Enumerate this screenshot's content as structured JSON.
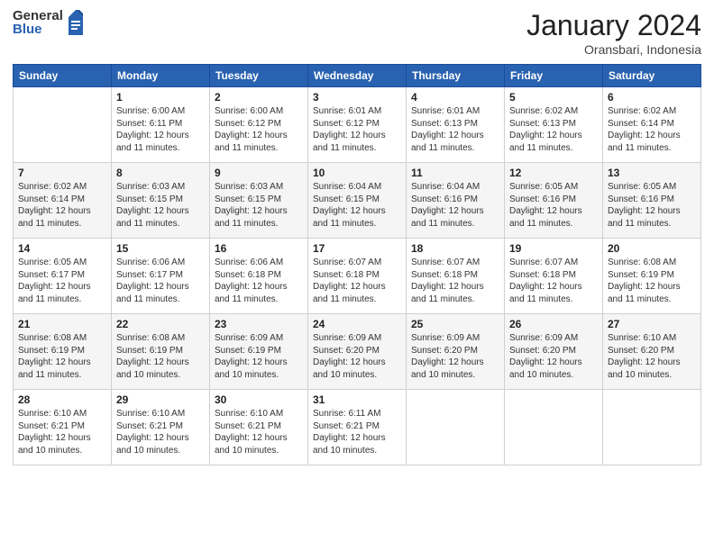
{
  "header": {
    "logo_general": "General",
    "logo_blue": "Blue",
    "title": "January 2024",
    "location": "Oransbari, Indonesia"
  },
  "weekdays": [
    "Sunday",
    "Monday",
    "Tuesday",
    "Wednesday",
    "Thursday",
    "Friday",
    "Saturday"
  ],
  "weeks": [
    [
      {
        "day": "",
        "sunrise": "",
        "sunset": "",
        "daylight": ""
      },
      {
        "day": "1",
        "sunrise": "Sunrise: 6:00 AM",
        "sunset": "Sunset: 6:11 PM",
        "daylight": "Daylight: 12 hours and 11 minutes."
      },
      {
        "day": "2",
        "sunrise": "Sunrise: 6:00 AM",
        "sunset": "Sunset: 6:12 PM",
        "daylight": "Daylight: 12 hours and 11 minutes."
      },
      {
        "day": "3",
        "sunrise": "Sunrise: 6:01 AM",
        "sunset": "Sunset: 6:12 PM",
        "daylight": "Daylight: 12 hours and 11 minutes."
      },
      {
        "day": "4",
        "sunrise": "Sunrise: 6:01 AM",
        "sunset": "Sunset: 6:13 PM",
        "daylight": "Daylight: 12 hours and 11 minutes."
      },
      {
        "day": "5",
        "sunrise": "Sunrise: 6:02 AM",
        "sunset": "Sunset: 6:13 PM",
        "daylight": "Daylight: 12 hours and 11 minutes."
      },
      {
        "day": "6",
        "sunrise": "Sunrise: 6:02 AM",
        "sunset": "Sunset: 6:14 PM",
        "daylight": "Daylight: 12 hours and 11 minutes."
      }
    ],
    [
      {
        "day": "7",
        "sunrise": "Sunrise: 6:02 AM",
        "sunset": "Sunset: 6:14 PM",
        "daylight": "Daylight: 12 hours and 11 minutes."
      },
      {
        "day": "8",
        "sunrise": "Sunrise: 6:03 AM",
        "sunset": "Sunset: 6:15 PM",
        "daylight": "Daylight: 12 hours and 11 minutes."
      },
      {
        "day": "9",
        "sunrise": "Sunrise: 6:03 AM",
        "sunset": "Sunset: 6:15 PM",
        "daylight": "Daylight: 12 hours and 11 minutes."
      },
      {
        "day": "10",
        "sunrise": "Sunrise: 6:04 AM",
        "sunset": "Sunset: 6:15 PM",
        "daylight": "Daylight: 12 hours and 11 minutes."
      },
      {
        "day": "11",
        "sunrise": "Sunrise: 6:04 AM",
        "sunset": "Sunset: 6:16 PM",
        "daylight": "Daylight: 12 hours and 11 minutes."
      },
      {
        "day": "12",
        "sunrise": "Sunrise: 6:05 AM",
        "sunset": "Sunset: 6:16 PM",
        "daylight": "Daylight: 12 hours and 11 minutes."
      },
      {
        "day": "13",
        "sunrise": "Sunrise: 6:05 AM",
        "sunset": "Sunset: 6:16 PM",
        "daylight": "Daylight: 12 hours and 11 minutes."
      }
    ],
    [
      {
        "day": "14",
        "sunrise": "Sunrise: 6:05 AM",
        "sunset": "Sunset: 6:17 PM",
        "daylight": "Daylight: 12 hours and 11 minutes."
      },
      {
        "day": "15",
        "sunrise": "Sunrise: 6:06 AM",
        "sunset": "Sunset: 6:17 PM",
        "daylight": "Daylight: 12 hours and 11 minutes."
      },
      {
        "day": "16",
        "sunrise": "Sunrise: 6:06 AM",
        "sunset": "Sunset: 6:18 PM",
        "daylight": "Daylight: 12 hours and 11 minutes."
      },
      {
        "day": "17",
        "sunrise": "Sunrise: 6:07 AM",
        "sunset": "Sunset: 6:18 PM",
        "daylight": "Daylight: 12 hours and 11 minutes."
      },
      {
        "day": "18",
        "sunrise": "Sunrise: 6:07 AM",
        "sunset": "Sunset: 6:18 PM",
        "daylight": "Daylight: 12 hours and 11 minutes."
      },
      {
        "day": "19",
        "sunrise": "Sunrise: 6:07 AM",
        "sunset": "Sunset: 6:18 PM",
        "daylight": "Daylight: 12 hours and 11 minutes."
      },
      {
        "day": "20",
        "sunrise": "Sunrise: 6:08 AM",
        "sunset": "Sunset: 6:19 PM",
        "daylight": "Daylight: 12 hours and 11 minutes."
      }
    ],
    [
      {
        "day": "21",
        "sunrise": "Sunrise: 6:08 AM",
        "sunset": "Sunset: 6:19 PM",
        "daylight": "Daylight: 12 hours and 11 minutes."
      },
      {
        "day": "22",
        "sunrise": "Sunrise: 6:08 AM",
        "sunset": "Sunset: 6:19 PM",
        "daylight": "Daylight: 12 hours and 10 minutes."
      },
      {
        "day": "23",
        "sunrise": "Sunrise: 6:09 AM",
        "sunset": "Sunset: 6:19 PM",
        "daylight": "Daylight: 12 hours and 10 minutes."
      },
      {
        "day": "24",
        "sunrise": "Sunrise: 6:09 AM",
        "sunset": "Sunset: 6:20 PM",
        "daylight": "Daylight: 12 hours and 10 minutes."
      },
      {
        "day": "25",
        "sunrise": "Sunrise: 6:09 AM",
        "sunset": "Sunset: 6:20 PM",
        "daylight": "Daylight: 12 hours and 10 minutes."
      },
      {
        "day": "26",
        "sunrise": "Sunrise: 6:09 AM",
        "sunset": "Sunset: 6:20 PM",
        "daylight": "Daylight: 12 hours and 10 minutes."
      },
      {
        "day": "27",
        "sunrise": "Sunrise: 6:10 AM",
        "sunset": "Sunset: 6:20 PM",
        "daylight": "Daylight: 12 hours and 10 minutes."
      }
    ],
    [
      {
        "day": "28",
        "sunrise": "Sunrise: 6:10 AM",
        "sunset": "Sunset: 6:21 PM",
        "daylight": "Daylight: 12 hours and 10 minutes."
      },
      {
        "day": "29",
        "sunrise": "Sunrise: 6:10 AM",
        "sunset": "Sunset: 6:21 PM",
        "daylight": "Daylight: 12 hours and 10 minutes."
      },
      {
        "day": "30",
        "sunrise": "Sunrise: 6:10 AM",
        "sunset": "Sunset: 6:21 PM",
        "daylight": "Daylight: 12 hours and 10 minutes."
      },
      {
        "day": "31",
        "sunrise": "Sunrise: 6:11 AM",
        "sunset": "Sunset: 6:21 PM",
        "daylight": "Daylight: 12 hours and 10 minutes."
      },
      {
        "day": "",
        "sunrise": "",
        "sunset": "",
        "daylight": ""
      },
      {
        "day": "",
        "sunrise": "",
        "sunset": "",
        "daylight": ""
      },
      {
        "day": "",
        "sunrise": "",
        "sunset": "",
        "daylight": ""
      }
    ]
  ]
}
